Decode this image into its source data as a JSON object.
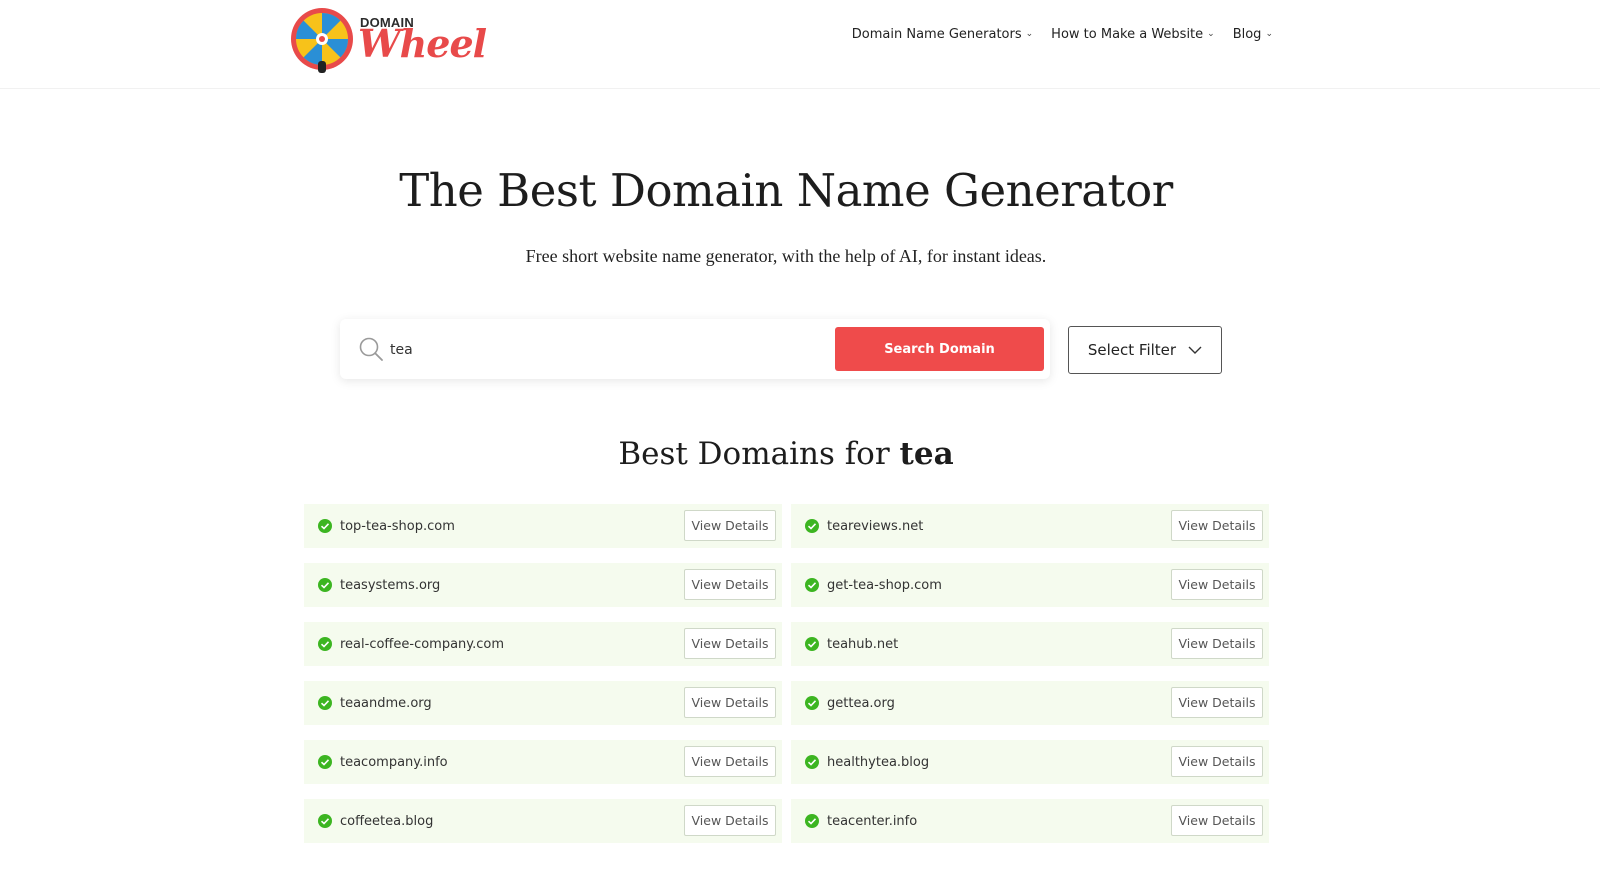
{
  "brand": {
    "small": "DOMAIN",
    "big": "Wheel"
  },
  "nav": [
    {
      "label": "Domain Name Generators"
    },
    {
      "label": "How to Make a Website"
    },
    {
      "label": "Blog"
    }
  ],
  "hero": {
    "title": "The Best Domain Name Generator",
    "subtitle": "Free short website name generator, with the help of AI, for instant ideas."
  },
  "search": {
    "value": "tea",
    "button": "Search Domain"
  },
  "filter": {
    "label": "Select Filter"
  },
  "results": {
    "title_prefix": "Best Domains for",
    "keyword": "tea",
    "view_label": "View Details",
    "items": [
      "top-tea-shop.com",
      "teareviews.net",
      "teasystems.org",
      "get-tea-shop.com",
      "real-coffee-company.com",
      "teahub.net",
      "teaandme.org",
      "gettea.org",
      "teacompany.info",
      "healthytea.blog",
      "coffeetea.blog",
      "teacenter.info"
    ]
  },
  "colors": {
    "accent": "#ef4b4b",
    "row_bg": "#f5fbee",
    "check": "#3cb521"
  },
  "icons": {
    "search": "search-icon",
    "check": "check-circle-icon",
    "chevron": "chevron-down-icon"
  }
}
